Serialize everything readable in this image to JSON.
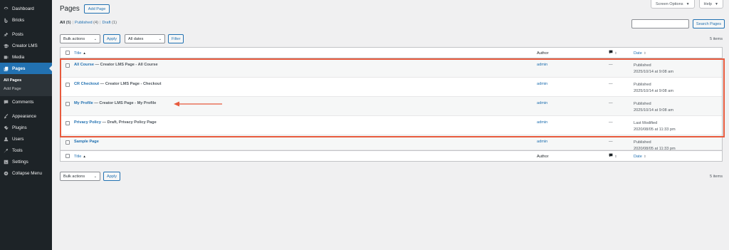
{
  "sidebar": {
    "items": [
      {
        "label": "Dashboard",
        "icon": "dashboard-icon"
      },
      {
        "label": "Bricks",
        "icon": "bricks-icon"
      },
      {
        "label": "Posts",
        "icon": "pin-icon"
      },
      {
        "label": "Creator LMS",
        "icon": "graduation-cap-icon"
      },
      {
        "label": "Media",
        "icon": "media-icon"
      },
      {
        "label": "Pages",
        "icon": "pages-icon"
      },
      {
        "label": "Comments",
        "icon": "comment-icon"
      },
      {
        "label": "Appearance",
        "icon": "brush-icon"
      },
      {
        "label": "Plugins",
        "icon": "plug-icon"
      },
      {
        "label": "Users",
        "icon": "user-icon"
      },
      {
        "label": "Tools",
        "icon": "wrench-icon"
      },
      {
        "label": "Settings",
        "icon": "settings-icon"
      },
      {
        "label": "Collapse Menu",
        "icon": "collapse-icon"
      }
    ],
    "submenu": [
      {
        "label": "All Pages"
      },
      {
        "label": "Add Page"
      }
    ]
  },
  "header": {
    "screen_options": "Screen Options",
    "help": "Help",
    "title": "Pages",
    "add_button": "Add Page"
  },
  "filters": {
    "all": "All",
    "all_count": "(5)",
    "published": "Published",
    "published_count": "(4)",
    "draft": "Draft",
    "draft_count": "(1)",
    "sep": "|"
  },
  "search": {
    "button": "Search Pages",
    "value": ""
  },
  "tablenav": {
    "bulk_actions": "Bulk actions",
    "apply": "Apply",
    "all_dates": "All dates",
    "filter": "Filter",
    "items": "5 items"
  },
  "table": {
    "columns": {
      "title": "Title",
      "author": "Author",
      "date": "Date"
    },
    "rows": [
      {
        "title": "All Course",
        "state": " — Creator LMS Page - All Course",
        "author": "admin",
        "comments": "—",
        "status": "Published",
        "date": "2025/10/14 at 9:08 am"
      },
      {
        "title": "CR Checkout",
        "state": " — Creator LMS Page - Checkout",
        "author": "admin",
        "comments": "—",
        "status": "Published",
        "date": "2025/10/14 at 9:08 am"
      },
      {
        "title": "My Profile",
        "state": " — Creator LMS Page - My Profile",
        "author": "admin",
        "comments": "—",
        "status": "Published",
        "date": "2025/10/14 at 9:08 am"
      },
      {
        "title": "Privacy Policy",
        "state": " — Draft, Privacy Policy Page",
        "author": "admin",
        "comments": "—",
        "status": "Last Modified",
        "date": "2020/08/05 at 11:33 pm"
      },
      {
        "title": "Sample Page",
        "state": "",
        "author": "admin",
        "comments": "—",
        "status": "Published",
        "date": "2020/08/05 at 11:33 pm"
      }
    ]
  },
  "colors": {
    "accent": "#2271b1",
    "sidebar_bg": "#1d2327",
    "highlight": "#e75a3d"
  }
}
